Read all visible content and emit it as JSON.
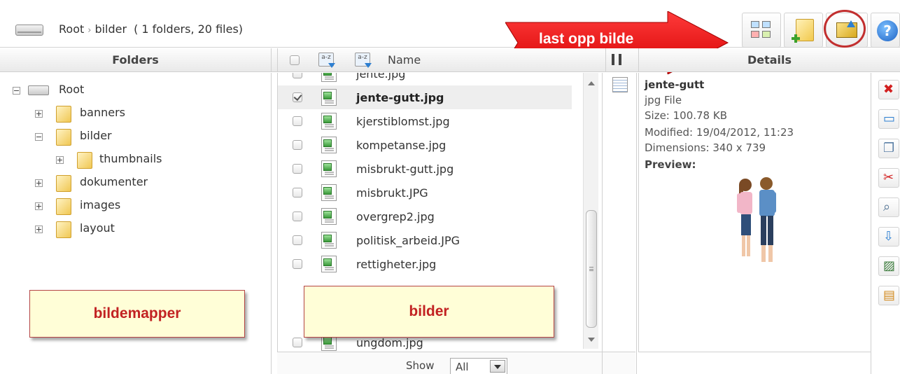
{
  "breadcrumb": {
    "root": "Root",
    "separator": "›",
    "current": "bilder",
    "count": "( 1 folders, 20 files)"
  },
  "toolbar": {
    "views_icon": "thumbnail-views-icon",
    "new_folder_icon": "new-folder-icon",
    "upload_icon": "upload-image-icon",
    "help_icon": "help-icon",
    "help_glyph": "?"
  },
  "annotation_arrow": {
    "label": "last opp bilde",
    "color": "#ff0000"
  },
  "headers": {
    "folders": "Folders",
    "name": "Name",
    "details": "Details",
    "sort_label": "a-z"
  },
  "folders": {
    "root": "Root",
    "items": [
      "banners",
      "bilder",
      "thumbnails",
      "dokumenter",
      "images",
      "layout"
    ]
  },
  "files": {
    "partial_top": "jente.jpg",
    "rows": [
      {
        "name": "jente-gutt.jpg",
        "checked": true,
        "selected": true
      },
      {
        "name": "kjerstiblomst.jpg",
        "checked": false,
        "selected": false
      },
      {
        "name": "kompetanse.jpg",
        "checked": false,
        "selected": false
      },
      {
        "name": "misbrukt-gutt.jpg",
        "checked": false,
        "selected": false
      },
      {
        "name": "misbrukt.JPG",
        "checked": false,
        "selected": false
      },
      {
        "name": "overgrep2.jpg",
        "checked": false,
        "selected": false
      },
      {
        "name": "politisk_arbeid.JPG",
        "checked": false,
        "selected": false
      },
      {
        "name": "rettigheter.jpg",
        "checked": false,
        "selected": false
      }
    ],
    "partial_bottom": "ungdom.jpg"
  },
  "footer": {
    "show_label": "Show",
    "show_value": "All"
  },
  "details": {
    "name": "jente-gutt",
    "type": "jpg File",
    "size": "Size: 100.78 KB",
    "modified": "Modified: 19/04/2012, 11:23",
    "dimensions": "Dimensions: 340 x 739",
    "preview_label": "Preview:"
  },
  "actions": [
    "delete-icon",
    "rename-icon",
    "copy-icon",
    "cut-icon",
    "zoom-icon",
    "download-icon",
    "edit-image-icon",
    "replace-image-icon"
  ],
  "notes": {
    "folders": "bildemapper",
    "files": "bilder"
  },
  "colors": {
    "note_bg": "#fffed7",
    "note_text": "#c22222",
    "accent_blue": "#2d7fd1"
  }
}
